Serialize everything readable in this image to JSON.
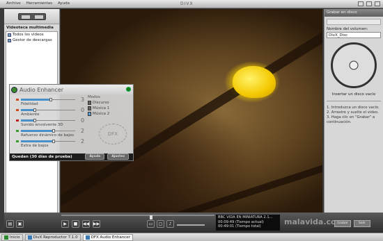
{
  "menu": [
    "Archivo",
    "Herramientas",
    "Ayuda"
  ],
  "window": {
    "title": "DIVX"
  },
  "left_panel": {
    "section": "Videoteca multimedia",
    "items": [
      "Todos los videos",
      "Gestor de descargas"
    ]
  },
  "right_panel": {
    "header": "Grabar en disco",
    "volume_label": "Nombre del volumen:",
    "volume_value": "DivX_Disc",
    "insert_text": "Insertar un disco vacío",
    "steps": [
      "1. Introduzca un disco vacío.",
      "2. Arrastre y suelte el video.",
      "3. Haga clic en \"Grabar\" a continuación."
    ]
  },
  "enhancer": {
    "title": "Audio Enhancer",
    "sliders": [
      {
        "label": "Fidelidad",
        "value": "3",
        "level": 0.55,
        "led": "#d04a20"
      },
      {
        "label": "Ambiente",
        "value": "0",
        "level": 0.25,
        "led": "#d04a20"
      },
      {
        "label": "Sonido envolvente 3D",
        "value": "0",
        "level": 0.25,
        "led": "#c02020"
      },
      {
        "label": "Refuerzo dinámico de bajos",
        "value": "2",
        "level": 0.6,
        "led": "#3a9a2a"
      },
      {
        "label": "Extra de bajos",
        "value": "2",
        "level": 0.6,
        "led": "#3a9a2a"
      }
    ],
    "modes_title": "Modos",
    "modes": [
      "Discurso",
      "Música 1",
      "Música 2"
    ],
    "active_mode": 2,
    "emblem": "DFX",
    "footer": "Quedan (30 días de prueba)",
    "buttons": [
      "Ayuda",
      "Ajustes"
    ]
  },
  "player": {
    "info_title": "BBC VIDA EN MINIATURA 2.1...",
    "time_current": "00:09:49",
    "time_current_label": "(Tiempo actual)",
    "time_total": "00:49:01",
    "time_total_label": "(Tiempo total)",
    "watermark": "malavida.com",
    "right_buttons": [
      "Grabar",
      "Salir"
    ]
  },
  "taskbar": {
    "start": "Inicio",
    "items": [
      "DivX Reproductor 7.1.0",
      "DFX Audio Enhancer"
    ]
  },
  "colors": {
    "accent": "#4a90c8",
    "enhancer_logo": "#3a8a2a"
  }
}
